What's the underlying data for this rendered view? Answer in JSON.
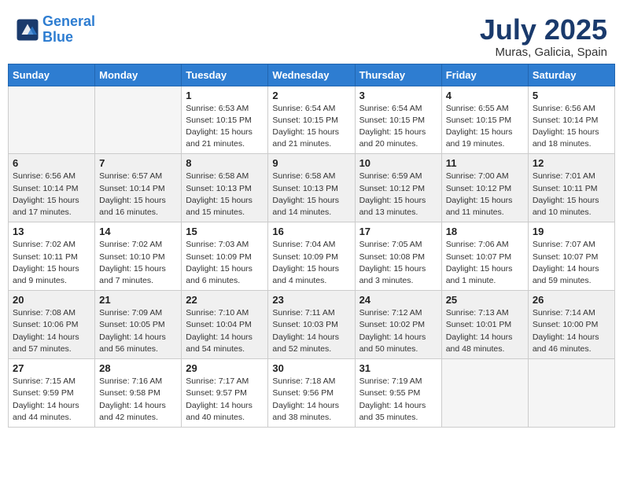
{
  "header": {
    "logo_line1": "General",
    "logo_line2": "Blue",
    "month": "July 2025",
    "location": "Muras, Galicia, Spain"
  },
  "weekdays": [
    "Sunday",
    "Monday",
    "Tuesday",
    "Wednesday",
    "Thursday",
    "Friday",
    "Saturday"
  ],
  "weeks": [
    [
      {
        "day": "",
        "info": ""
      },
      {
        "day": "",
        "info": ""
      },
      {
        "day": "1",
        "info": "Sunrise: 6:53 AM\nSunset: 10:15 PM\nDaylight: 15 hours\nand 21 minutes."
      },
      {
        "day": "2",
        "info": "Sunrise: 6:54 AM\nSunset: 10:15 PM\nDaylight: 15 hours\nand 21 minutes."
      },
      {
        "day": "3",
        "info": "Sunrise: 6:54 AM\nSunset: 10:15 PM\nDaylight: 15 hours\nand 20 minutes."
      },
      {
        "day": "4",
        "info": "Sunrise: 6:55 AM\nSunset: 10:15 PM\nDaylight: 15 hours\nand 19 minutes."
      },
      {
        "day": "5",
        "info": "Sunrise: 6:56 AM\nSunset: 10:14 PM\nDaylight: 15 hours\nand 18 minutes."
      }
    ],
    [
      {
        "day": "6",
        "info": "Sunrise: 6:56 AM\nSunset: 10:14 PM\nDaylight: 15 hours\nand 17 minutes."
      },
      {
        "day": "7",
        "info": "Sunrise: 6:57 AM\nSunset: 10:14 PM\nDaylight: 15 hours\nand 16 minutes."
      },
      {
        "day": "8",
        "info": "Sunrise: 6:58 AM\nSunset: 10:13 PM\nDaylight: 15 hours\nand 15 minutes."
      },
      {
        "day": "9",
        "info": "Sunrise: 6:58 AM\nSunset: 10:13 PM\nDaylight: 15 hours\nand 14 minutes."
      },
      {
        "day": "10",
        "info": "Sunrise: 6:59 AM\nSunset: 10:12 PM\nDaylight: 15 hours\nand 13 minutes."
      },
      {
        "day": "11",
        "info": "Sunrise: 7:00 AM\nSunset: 10:12 PM\nDaylight: 15 hours\nand 11 minutes."
      },
      {
        "day": "12",
        "info": "Sunrise: 7:01 AM\nSunset: 10:11 PM\nDaylight: 15 hours\nand 10 minutes."
      }
    ],
    [
      {
        "day": "13",
        "info": "Sunrise: 7:02 AM\nSunset: 10:11 PM\nDaylight: 15 hours\nand 9 minutes."
      },
      {
        "day": "14",
        "info": "Sunrise: 7:02 AM\nSunset: 10:10 PM\nDaylight: 15 hours\nand 7 minutes."
      },
      {
        "day": "15",
        "info": "Sunrise: 7:03 AM\nSunset: 10:09 PM\nDaylight: 15 hours\nand 6 minutes."
      },
      {
        "day": "16",
        "info": "Sunrise: 7:04 AM\nSunset: 10:09 PM\nDaylight: 15 hours\nand 4 minutes."
      },
      {
        "day": "17",
        "info": "Sunrise: 7:05 AM\nSunset: 10:08 PM\nDaylight: 15 hours\nand 3 minutes."
      },
      {
        "day": "18",
        "info": "Sunrise: 7:06 AM\nSunset: 10:07 PM\nDaylight: 15 hours\nand 1 minute."
      },
      {
        "day": "19",
        "info": "Sunrise: 7:07 AM\nSunset: 10:07 PM\nDaylight: 14 hours\nand 59 minutes."
      }
    ],
    [
      {
        "day": "20",
        "info": "Sunrise: 7:08 AM\nSunset: 10:06 PM\nDaylight: 14 hours\nand 57 minutes."
      },
      {
        "day": "21",
        "info": "Sunrise: 7:09 AM\nSunset: 10:05 PM\nDaylight: 14 hours\nand 56 minutes."
      },
      {
        "day": "22",
        "info": "Sunrise: 7:10 AM\nSunset: 10:04 PM\nDaylight: 14 hours\nand 54 minutes."
      },
      {
        "day": "23",
        "info": "Sunrise: 7:11 AM\nSunset: 10:03 PM\nDaylight: 14 hours\nand 52 minutes."
      },
      {
        "day": "24",
        "info": "Sunrise: 7:12 AM\nSunset: 10:02 PM\nDaylight: 14 hours\nand 50 minutes."
      },
      {
        "day": "25",
        "info": "Sunrise: 7:13 AM\nSunset: 10:01 PM\nDaylight: 14 hours\nand 48 minutes."
      },
      {
        "day": "26",
        "info": "Sunrise: 7:14 AM\nSunset: 10:00 PM\nDaylight: 14 hours\nand 46 minutes."
      }
    ],
    [
      {
        "day": "27",
        "info": "Sunrise: 7:15 AM\nSunset: 9:59 PM\nDaylight: 14 hours\nand 44 minutes."
      },
      {
        "day": "28",
        "info": "Sunrise: 7:16 AM\nSunset: 9:58 PM\nDaylight: 14 hours\nand 42 minutes."
      },
      {
        "day": "29",
        "info": "Sunrise: 7:17 AM\nSunset: 9:57 PM\nDaylight: 14 hours\nand 40 minutes."
      },
      {
        "day": "30",
        "info": "Sunrise: 7:18 AM\nSunset: 9:56 PM\nDaylight: 14 hours\nand 38 minutes."
      },
      {
        "day": "31",
        "info": "Sunrise: 7:19 AM\nSunset: 9:55 PM\nDaylight: 14 hours\nand 35 minutes."
      },
      {
        "day": "",
        "info": ""
      },
      {
        "day": "",
        "info": ""
      }
    ]
  ]
}
